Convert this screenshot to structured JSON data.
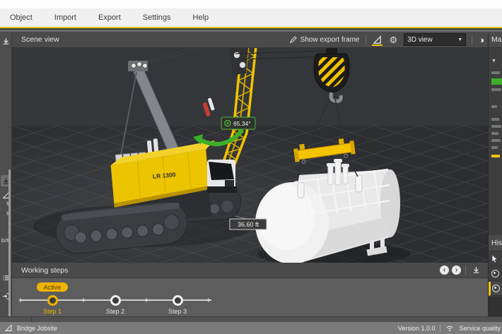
{
  "menu": {
    "items": [
      "Object",
      "Import",
      "Export",
      "Settings",
      "Help"
    ]
  },
  "scene_view": {
    "title": "Scene view",
    "show_export_frame_label": "Show export frame",
    "view_dropdown_value": "3D view",
    "crane_model_label": "LR 1300",
    "boom_angle_label": "65.34°",
    "radius_label": "36.60 ft"
  },
  "working_steps": {
    "title": "Working steps",
    "active_badge": "Active",
    "steps": [
      {
        "label": "Step 1",
        "state": "active"
      },
      {
        "label": "Step 2",
        "state": "normal"
      },
      {
        "label": "Step 3",
        "state": "normal"
      }
    ]
  },
  "left_rail": {
    "unit_label_1": "ft",
    "unit_label_2": "ft",
    "unit_label_3": "lb/ft"
  },
  "right_panel": {
    "machine_header_partial": "Mac",
    "history_header_partial": "Hist"
  },
  "status_bar": {
    "jobsite": "Bridge Jobsite",
    "version": "Version 1.0.0",
    "service_quality": "Service quality"
  },
  "colors": {
    "accent_yellow": "#f2c200",
    "active_yellow": "#f0b400",
    "menu_underline": "#f6c700",
    "ok_green": "#3fae2a"
  }
}
